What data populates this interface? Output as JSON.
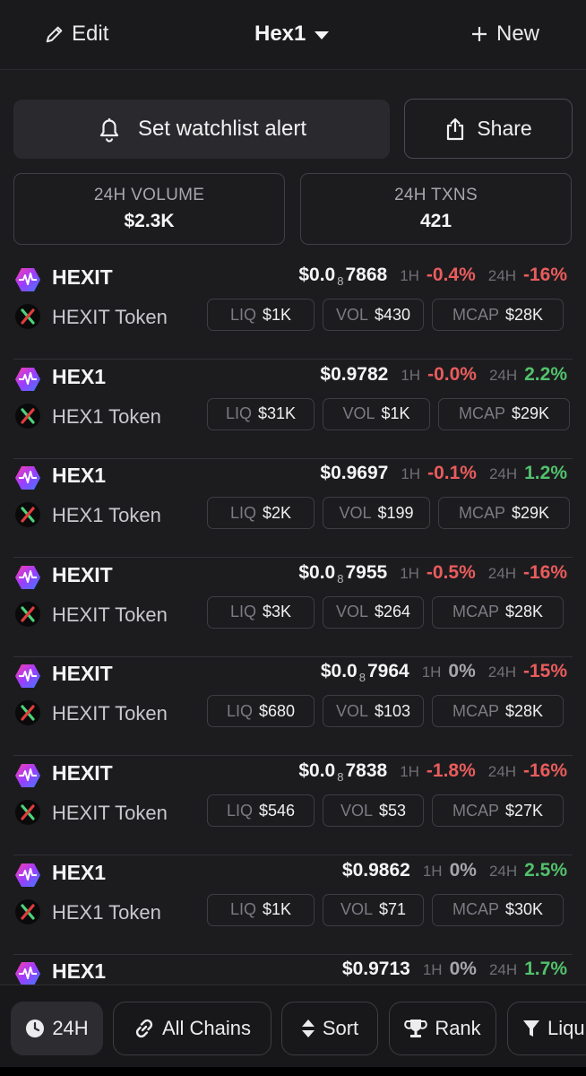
{
  "header": {
    "edit_label": "Edit",
    "title": "Hex1",
    "new_label": "New"
  },
  "actions": {
    "alert_label": "Set watchlist alert",
    "share_label": "Share"
  },
  "stats": [
    {
      "label": "24H VOLUME",
      "value": "$2.3K"
    },
    {
      "label": "24H TXNS",
      "value": "421"
    }
  ],
  "colors": {
    "negative": "#ea5c5c",
    "positive": "#52c16c",
    "background": "#1c1c1f"
  },
  "tokens": [
    {
      "symbol": "HEXIT",
      "name": "HEXIT Token",
      "price_main": "$0.0",
      "price_sub": "8",
      "price_tail": "7868",
      "h1_label": "1H",
      "h1": "-0.4%",
      "h1_dir": "neg",
      "h24_label": "24H",
      "h24": "-16%",
      "h24_dir": "neg",
      "liq_label": "LIQ",
      "liq": "$1K",
      "vol_label": "VOL",
      "vol": "$430",
      "mcap_label": "MCAP",
      "mcap": "$28K"
    },
    {
      "symbol": "HEX1",
      "name": "HEX1 Token",
      "price_main": "$0.9782",
      "price_sub": "",
      "price_tail": "",
      "h1_label": "1H",
      "h1": "-0.0%",
      "h1_dir": "neg",
      "h24_label": "24H",
      "h24": "2.2%",
      "h24_dir": "pos",
      "liq_label": "LIQ",
      "liq": "$31K",
      "vol_label": "VOL",
      "vol": "$1K",
      "mcap_label": "MCAP",
      "mcap": "$29K"
    },
    {
      "symbol": "HEX1",
      "name": "HEX1 Token",
      "price_main": "$0.9697",
      "price_sub": "",
      "price_tail": "",
      "h1_label": "1H",
      "h1": "-0.1%",
      "h1_dir": "neg",
      "h24_label": "24H",
      "h24": "1.2%",
      "h24_dir": "pos",
      "liq_label": "LIQ",
      "liq": "$2K",
      "vol_label": "VOL",
      "vol": "$199",
      "mcap_label": "MCAP",
      "mcap": "$29K"
    },
    {
      "symbol": "HEXIT",
      "name": "HEXIT Token",
      "price_main": "$0.0",
      "price_sub": "8",
      "price_tail": "7955",
      "h1_label": "1H",
      "h1": "-0.5%",
      "h1_dir": "neg",
      "h24_label": "24H",
      "h24": "-16%",
      "h24_dir": "neg",
      "liq_label": "LIQ",
      "liq": "$3K",
      "vol_label": "VOL",
      "vol": "$264",
      "mcap_label": "MCAP",
      "mcap": "$28K"
    },
    {
      "symbol": "HEXIT",
      "name": "HEXIT Token",
      "price_main": "$0.0",
      "price_sub": "8",
      "price_tail": "7964",
      "h1_label": "1H",
      "h1": "0%",
      "h1_dir": "neu",
      "h24_label": "24H",
      "h24": "-15%",
      "h24_dir": "neg",
      "liq_label": "LIQ",
      "liq": "$680",
      "vol_label": "VOL",
      "vol": "$103",
      "mcap_label": "MCAP",
      "mcap": "$28K"
    },
    {
      "symbol": "HEXIT",
      "name": "HEXIT Token",
      "price_main": "$0.0",
      "price_sub": "8",
      "price_tail": "7838",
      "h1_label": "1H",
      "h1": "-1.8%",
      "h1_dir": "neg",
      "h24_label": "24H",
      "h24": "-16%",
      "h24_dir": "neg",
      "liq_label": "LIQ",
      "liq": "$546",
      "vol_label": "VOL",
      "vol": "$53",
      "mcap_label": "MCAP",
      "mcap": "$27K"
    },
    {
      "symbol": "HEX1",
      "name": "HEX1 Token",
      "price_main": "$0.9862",
      "price_sub": "",
      "price_tail": "",
      "h1_label": "1H",
      "h1": "0%",
      "h1_dir": "neu",
      "h24_label": "24H",
      "h24": "2.5%",
      "h24_dir": "pos",
      "liq_label": "LIQ",
      "liq": "$1K",
      "vol_label": "VOL",
      "vol": "$71",
      "mcap_label": "MCAP",
      "mcap": "$30K"
    },
    {
      "symbol": "HEX1",
      "name": "",
      "price_main": "$0.9713",
      "price_sub": "",
      "price_tail": "",
      "h1_label": "1H",
      "h1": "0%",
      "h1_dir": "neu",
      "h24_label": "24H",
      "h24": "1.7%",
      "h24_dir": "pos",
      "liq_label": "",
      "liq": "",
      "vol_label": "",
      "vol": "",
      "mcap_label": "",
      "mcap": ""
    }
  ],
  "filters": [
    {
      "label": "24H",
      "icon": "clock-icon",
      "active": true
    },
    {
      "label": "All Chains",
      "icon": "link-icon",
      "active": false
    },
    {
      "label": "Sort",
      "icon": "sort-icon",
      "active": false
    },
    {
      "label": "Rank",
      "icon": "trophy-icon",
      "active": false
    },
    {
      "label": "Liqu",
      "icon": "filter-icon",
      "active": false
    }
  ]
}
